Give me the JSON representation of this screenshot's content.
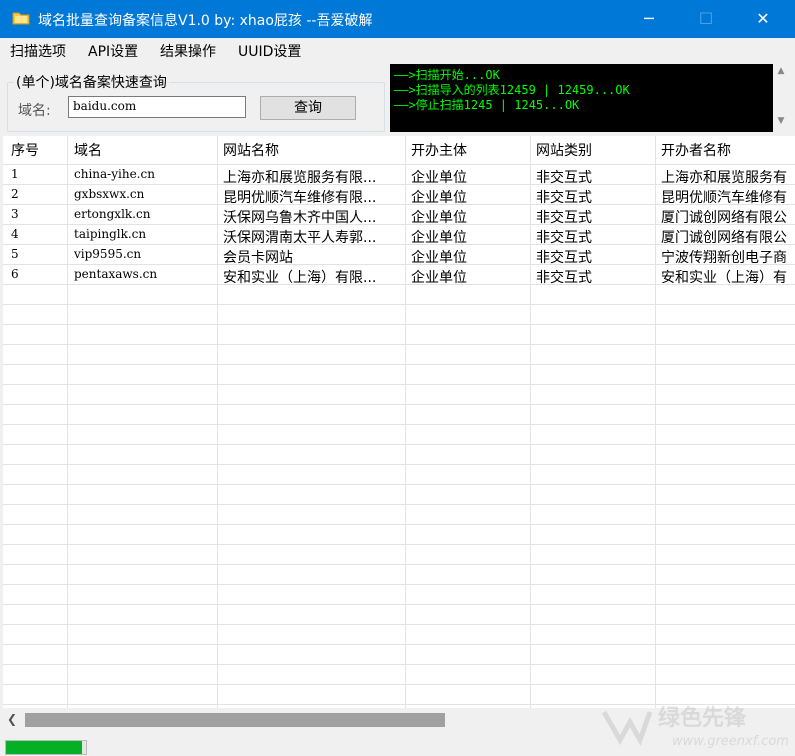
{
  "window": {
    "title": "域名批量查询备案信息V1.0   by: xhao屁孩   --吾爱破解",
    "controls": {
      "minimize": "─",
      "maximize": "☐",
      "close": "✕"
    }
  },
  "menu": [
    "扫描选项",
    "API设置",
    "结果操作",
    "UUID设置"
  ],
  "quick_query": {
    "group_title": "(单个)域名备案快速查询",
    "domain_label": "域名:",
    "domain_value": "baidu.com",
    "query_button": "查询"
  },
  "log": [
    "——>扫描开始...OK",
    "——>扫描导入的列表12459 | 12459...OK",
    "——>停止扫描1245 | 1245...OK"
  ],
  "table": {
    "columns": [
      "序号",
      "域名",
      "网站名称",
      "开办主体",
      "网站类别",
      "开办者名称"
    ],
    "rows": [
      [
        "1",
        "china-yihe.cn",
        "上海亦和展览服务有限...",
        "企业单位",
        "非交互式",
        "上海亦和展览服务有"
      ],
      [
        "2",
        "gxbsxwx.cn",
        "昆明优顺汽车维修有限...",
        "企业单位",
        "非交互式",
        "昆明优顺汽车维修有"
      ],
      [
        "3",
        "ertongxlk.cn",
        "沃保网乌鲁木齐中国人...",
        "企业单位",
        "非交互式",
        "厦门诚创网络有限公"
      ],
      [
        "4",
        "taipinglk.cn",
        "沃保网渭南太平人寿郭...",
        "企业单位",
        "非交互式",
        "厦门诚创网络有限公"
      ],
      [
        "5",
        "vip9595.cn",
        "会员卡网站",
        "企业单位",
        "非交互式",
        "宁波传翔新创电子商"
      ],
      [
        "6",
        "pentaxaws.cn",
        "安和实业（上海）有限...",
        "企业单位",
        "非交互式",
        "安和实业（上海）有"
      ]
    ]
  },
  "progress": {
    "fraction": 0.95
  },
  "watermark": {
    "text": "绿色先锋",
    "url": "www.greenxf.com"
  },
  "colors": {
    "titlebar": "#0078d7",
    "log_text": "#00ff00",
    "progress": "#06b025"
  }
}
